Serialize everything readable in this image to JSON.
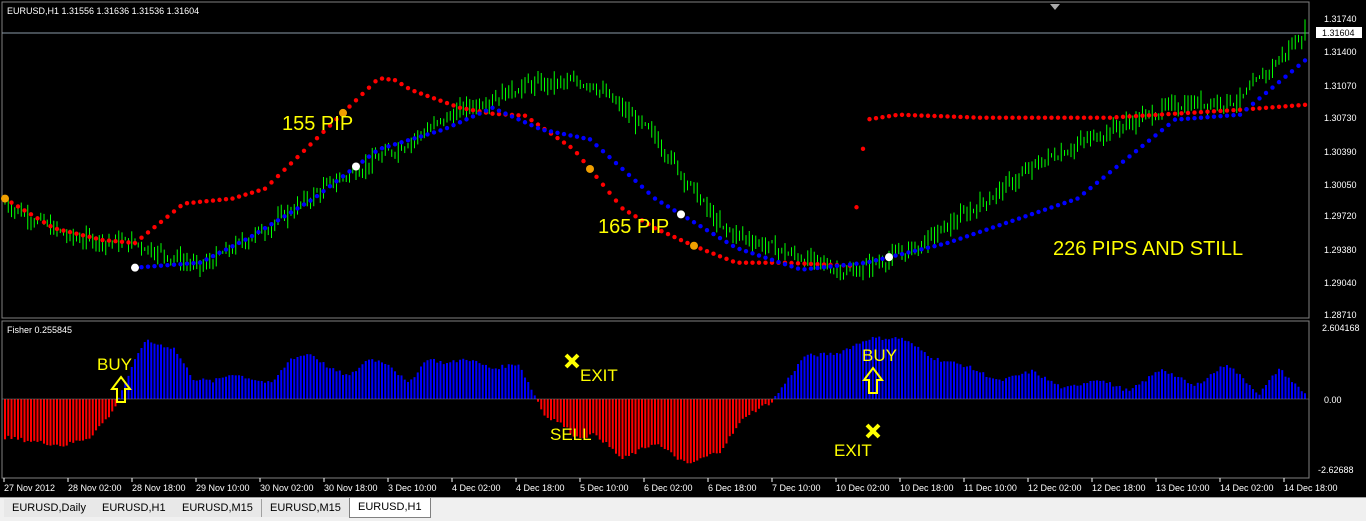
{
  "colors": {
    "background": "#000000",
    "grid": "#808080",
    "bull_candle": "#00ff00",
    "bear_candle": "#00ff00",
    "red_line": "#ff0000",
    "blue_line": "#0000ff",
    "annotation": "#ffff00",
    "fisher_pos": "#0000ff",
    "fisher_neg": "#ff0000",
    "axis_text": "#ffffff"
  },
  "main_chart": {
    "header": "EURUSD,H1  1.31556 1.31636 1.31536 1.31604",
    "current_price": "1.31604",
    "price_ticks": [
      "1.31740",
      "1.31400",
      "1.31070",
      "1.30730",
      "1.30390",
      "1.30050",
      "1.29720",
      "1.29380",
      "1.29040",
      "1.28710"
    ],
    "annotations": [
      "155 PIP",
      "165 PIP",
      "226 PIPS AND STILL"
    ]
  },
  "fisher_panel": {
    "header": "Fisher 0.255845",
    "ticks": [
      "2.604168",
      "0.00",
      "-2.62688"
    ],
    "labels": {
      "buy1": "BUY",
      "exit1": "EXIT",
      "sell": "SELL",
      "exit2": "EXIT",
      "buy2": "BUY"
    }
  },
  "time_axis": [
    "27 Nov 2012",
    "28 Nov 02:00",
    "28 Nov 18:00",
    "29 Nov 10:00",
    "30 Nov 02:00",
    "30 Nov 18:00",
    "3 Dec 10:00",
    "4 Dec 02:00",
    "4 Dec 18:00",
    "5 Dec 10:00",
    "6 Dec 02:00",
    "6 Dec 18:00",
    "7 Dec 10:00",
    "10 Dec 02:00",
    "10 Dec 18:00",
    "11 Dec 10:00",
    "12 Dec 02:00",
    "12 Dec 18:00",
    "13 Dec 10:00",
    "14 Dec 02:00",
    "14 Dec 18:00"
  ],
  "tabs": [
    "EURUSD,Daily",
    "EURUSD,H1",
    "EURUSD,M15",
    "EURUSD,M15",
    "EURUSD,H1"
  ],
  "active_tab_index": 4,
  "chart_data": {
    "type": "line",
    "title": "EURUSD,H1",
    "xlabel": "",
    "ylabel": "",
    "ylim": [
      1.2871,
      1.3174
    ],
    "price_anchors": {
      "x": [
        0,
        20,
        40,
        60,
        80,
        100,
        120,
        140,
        160,
        180,
        200,
        220,
        240,
        260,
        280,
        300,
        320,
        340,
        360,
        380,
        400
      ],
      "close": [
        1.2985,
        1.295,
        1.2945,
        1.292,
        1.296,
        1.3005,
        1.304,
        1.308,
        1.3105,
        1.3108,
        1.3052,
        1.296,
        1.2935,
        1.2915,
        1.294,
        1.2985,
        1.303,
        1.306,
        1.3085,
        1.309,
        1.316
      ]
    },
    "series": [
      {
        "name": "",
        "color": "#ff0000",
        "x": [
          0,
          15,
          30,
          40,
          55,
          70,
          80,
          115,
          120,
          125,
          140,
          150,
          160,
          175,
          190,
          200,
          210,
          215,
          225,
          240,
          260,
          265,
          275,
          300,
          340,
          380,
          400
        ],
        "values": [
          1.299,
          1.296,
          1.2948,
          1.2945,
          1.2985,
          1.299,
          1.3,
          1.3112,
          1.311,
          1.31,
          1.3082,
          1.3076,
          1.3074,
          1.304,
          1.298,
          1.296,
          1.2945,
          1.2938,
          1.2925,
          1.2925,
          1.2922,
          1.307,
          1.3075,
          1.3072,
          1.3072,
          1.308,
          1.3085
        ]
      },
      {
        "name": "",
        "color": "#0000ff",
        "x": [
          40,
          60,
          75,
          95,
          115,
          135,
          150,
          165,
          180,
          200,
          225,
          245,
          265,
          290,
          330,
          360,
          380,
          400
        ],
        "values": [
          1.292,
          1.2925,
          1.295,
          1.299,
          1.304,
          1.306,
          1.3082,
          1.306,
          1.305,
          1.299,
          1.294,
          1.2918,
          1.2925,
          1.2945,
          1.299,
          1.307,
          1.3075,
          1.313
        ]
      }
    ],
    "fisher": {
      "ylim": [
        -2.62688,
        2.604168
      ],
      "x": [
        0,
        18,
        26,
        33,
        40,
        43,
        46,
        52,
        58,
        64,
        70,
        76,
        82,
        88,
        94,
        100,
        106,
        112,
        118,
        124,
        130,
        136,
        142,
        150,
        158,
        166,
        170,
        176,
        182,
        190,
        200,
        210,
        220,
        228,
        236,
        246,
        256,
        266,
        276,
        286,
        296,
        306,
        316,
        326,
        336,
        346,
        356,
        366,
        376,
        386,
        392,
        400
      ],
      "values": [
        -1.4,
        -1.7,
        -1.4,
        -0.5,
        1.5,
        2.3,
        2.2,
        2.0,
        0.8,
        0.7,
        1.0,
        0.8,
        0.6,
        1.6,
        1.8,
        1.2,
        0.9,
        1.6,
        1.4,
        0.6,
        1.6,
        1.4,
        1.6,
        1.2,
        1.4,
        -0.6,
        -0.8,
        -1.4,
        -1.3,
        -2.2,
        -1.6,
        -2.4,
        -1.9,
        -0.6,
        -0.1,
        1.7,
        1.8,
        2.4,
        2.4,
        1.6,
        1.3,
        0.7,
        1.1,
        0.4,
        0.8,
        0.3,
        1.2,
        0.5,
        1.4,
        0.2,
        1.2,
        0.2
      ]
    },
    "signals": [
      {
        "label": "BUY",
        "x": 40
      },
      {
        "label": "EXIT",
        "x": 170
      },
      {
        "label": "SELL",
        "x": 176
      },
      {
        "label": "EXIT",
        "x": 236
      },
      {
        "label": "BUY",
        "x": 246
      }
    ]
  }
}
